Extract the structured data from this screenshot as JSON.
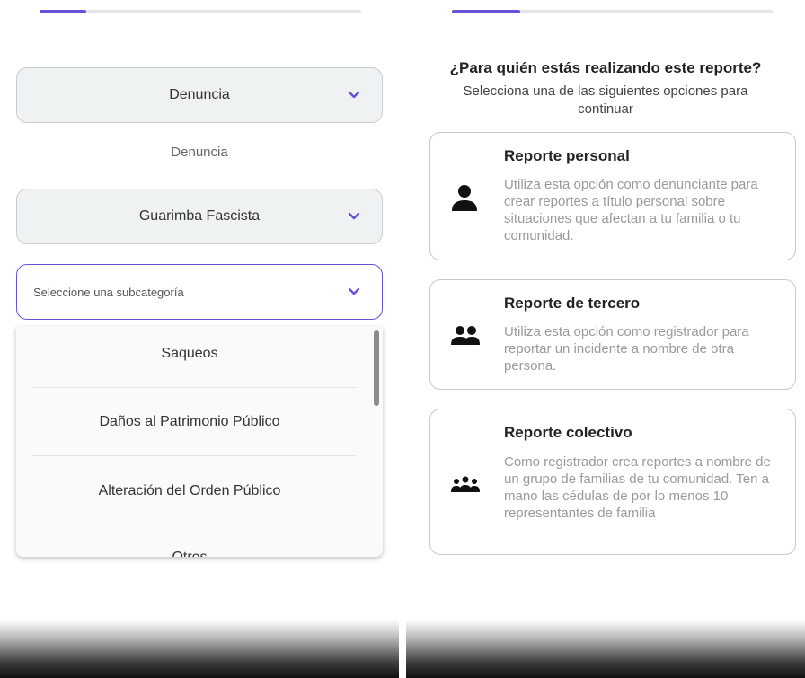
{
  "left_screen": {
    "select_1": {
      "value": "Denuncia"
    },
    "caption": "Denuncia",
    "select_2": {
      "value": "Guarimba Fascista"
    },
    "select_3": {
      "placeholder": "Seleccione una subcategoría"
    },
    "dropdown_options": [
      "Saqueos",
      "Daños al Patrimonio Público",
      "Alteración del Orden Público",
      "Otros"
    ],
    "progress_fraction": 0.15
  },
  "right_screen": {
    "question": "¿Para quién estás realizando este reporte?",
    "subtitle": "Selecciona una de las siguientes opciones para continuar",
    "cards": [
      {
        "title": "Reporte personal",
        "description": "Utiliza esta opción como denunciante para crear reportes a título personal sobre situaciones que afectan a tu familia o tu comunidad.",
        "icon": "person-icon"
      },
      {
        "title": "Reporte de tercero",
        "description": "Utiliza esta opción como registrador para reportar un incidente a nombre de otra persona.",
        "icon": "two-people-icon"
      },
      {
        "title": "Reporte colectivo",
        "description": "Como registrador crea reportes a nombre de un grupo de familias de tu comunidad. Ten a mano las cédulas de por lo menos 10 representantes de familia",
        "icon": "group-icon"
      }
    ],
    "progress_fraction": 0.21
  },
  "colors": {
    "accent": "#6a4fd8",
    "field_bg": "#eef2f3",
    "border": "#c9cdd1",
    "muted_text": "#9a9a9a"
  }
}
